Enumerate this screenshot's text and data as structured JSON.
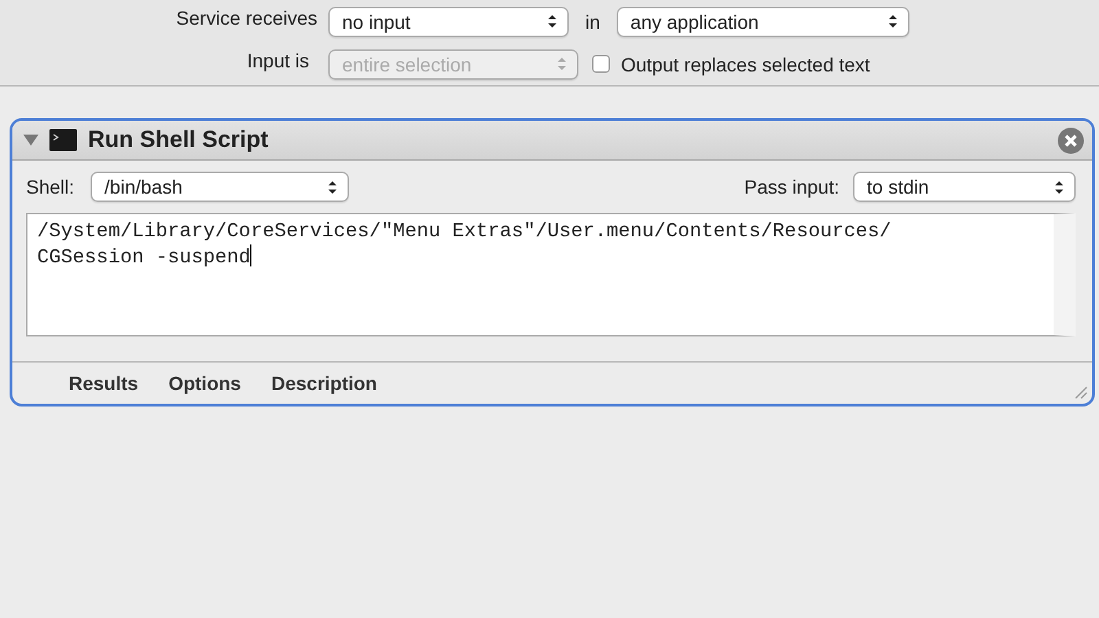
{
  "service": {
    "receives_label": "Service receives",
    "receives_value": "no input",
    "in_label": "in",
    "in_value": "any application",
    "input_is_label": "Input is",
    "input_is_value": "entire selection",
    "input_is_disabled": true,
    "output_replaces": {
      "label": "Output replaces selected text",
      "checked": false
    }
  },
  "action": {
    "title": "Run Shell Script",
    "expanded": true,
    "shell_label": "Shell:",
    "shell_value": "/bin/bash",
    "pass_input_label": "Pass input:",
    "pass_input_value": "to stdin",
    "script_lines": [
      "/System/Library/CoreServices/\"Menu Extras\"/User.menu/Contents/Resources/",
      "CGSession -suspend"
    ],
    "footer_tabs": [
      "Results",
      "Options",
      "Description"
    ]
  }
}
